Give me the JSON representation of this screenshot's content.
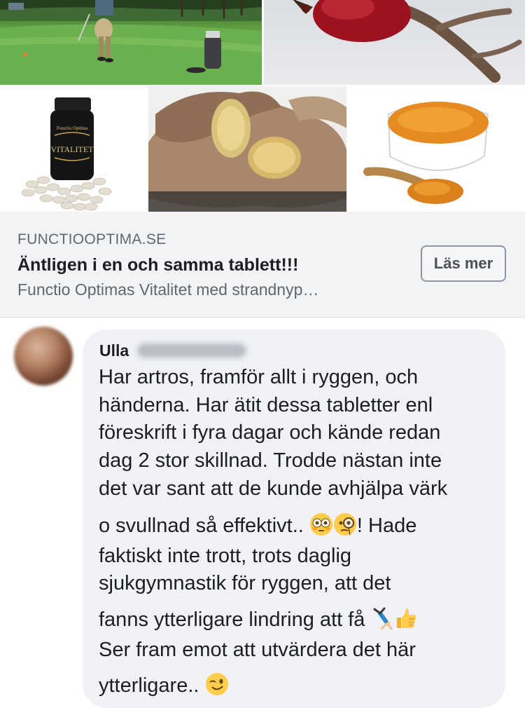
{
  "link_preview": {
    "domain": "FUNCTIOOPTIMA.SE",
    "title": "Äntligen i en och samma tablett!!!",
    "description": "Functio Optimas Vitalitet med strandnyp…",
    "button_label": "Läs mer",
    "product_label_top": "Functio Optima",
    "product_label_main": "VITALITET"
  },
  "comment": {
    "author": "Ulla",
    "lines": [
      "Har artros, framför allt i ryggen, och",
      "händerna. Har ätit dessa tabletter enl",
      "föreskrift i fyra dagar och kände redan",
      "dag 2 stor skillnad. Trodde nästan inte",
      "det var sant att de kunde avhjälpa värk",
      "o svullnad så effektivt.. ",
      "! Hade",
      "faktiskt inte trott, trots daglig",
      "sjukgymnastik för ryggen, att det",
      "fanns ytterligare lindring att få ",
      "Ser fram emot att utvärdera det här",
      "ytterligare.. "
    ]
  },
  "icons": {
    "emoji_1": "flushed-face-emoji",
    "emoji_2": "face-with-monocle-emoji",
    "emoji_3": "person-cartwheeling-emoji",
    "emoji_4": "thumbs-up-emoji",
    "emoji_5": "winking-face-emoji"
  },
  "colors": {
    "bubble_bg": "#f0f2f5",
    "preview_bg": "#f2f3f5",
    "secondary_text": "#606770"
  }
}
